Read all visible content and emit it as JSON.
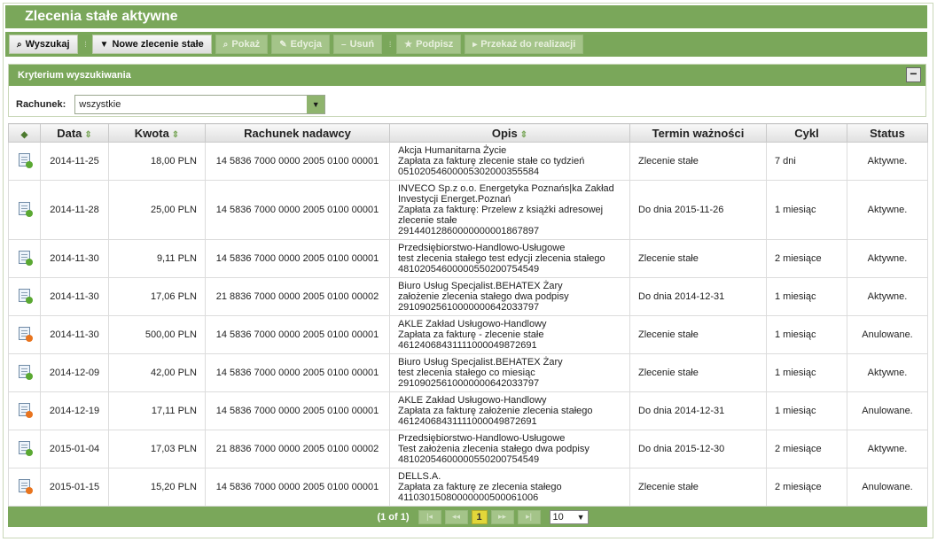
{
  "page_title": "Zlecenia stałe aktywne",
  "toolbar": {
    "buttons": [
      {
        "label": "Wyszukaj",
        "icon": "search-icon",
        "enabled": true
      },
      {
        "label": "Nowe zlecenie stałe",
        "icon": "dropdown-arrow-icon",
        "enabled": true
      },
      {
        "label": "Pokaż",
        "icon": "magnifier-icon",
        "enabled": false
      },
      {
        "label": "Edycja",
        "icon": "pencil-icon",
        "enabled": false
      },
      {
        "label": "Usuń",
        "icon": "minus-icon",
        "enabled": false
      },
      {
        "label": "Podpisz",
        "icon": "star-icon",
        "enabled": false
      },
      {
        "label": "Przekaż do realizacji",
        "icon": "arrow-right-icon",
        "enabled": false
      }
    ]
  },
  "criteria": {
    "title": "Kryterium wyszukiwania",
    "collapse_symbol": "−",
    "account_label": "Rachunek:",
    "account_value": "wszystkie"
  },
  "table": {
    "columns": [
      "",
      "Data",
      "Kwota",
      "Rachunek nadawcy",
      "Opis",
      "Termin ważności",
      "Cykl",
      "Status"
    ],
    "sort_symbol": "⇕",
    "rows": [
      {
        "status_icon": "active",
        "date": "2014-11-25",
        "amount": "18,00 PLN",
        "account": "14 5836 7000 0000 2005 0100 00001",
        "desc": [
          "Akcja Humanitarna Życie",
          "Zapłata za fakturę zlecenie stałe co tydzień",
          "05102054600005302000355584"
        ],
        "validity": "Zlecenie stałe",
        "cycle": "7 dni",
        "status": "Aktywne."
      },
      {
        "status_icon": "active",
        "date": "2014-11-28",
        "amount": "25,00 PLN",
        "account": "14 5836 7000 0000 2005 0100 00001",
        "desc": [
          "INVECO Sp.z o.o. Energetyka Poznańs|ka Zakład",
          "Investycji Energet.Poznań",
          "Zapłata za fakturę: Przelew z książki adresowej",
          "zlecenie stałe",
          "29144012860000000001867897"
        ],
        "validity": "Do dnia 2015-11-26",
        "cycle": "1 miesiąc",
        "status": "Aktywne."
      },
      {
        "status_icon": "active",
        "date": "2014-11-30",
        "amount": "9,11 PLN",
        "account": "14 5836 7000 0000 2005 0100 00001",
        "desc": [
          "Przedsiębiorstwo-Handlowo-Usługowe",
          "test zlecenia stałego test edycji zlecenia stałego",
          "48102054600000550200754549"
        ],
        "validity": "Zlecenie stałe",
        "cycle": "2 miesiące",
        "status": "Aktywne."
      },
      {
        "status_icon": "active",
        "date": "2014-11-30",
        "amount": "17,06 PLN",
        "account": "21 8836 7000 0000 2005 0100 00002",
        "desc": [
          "Biuro Usług Specjalist.BEHATEX Żary",
          "założenie zlecenia stałego dwa podpisy",
          "29109025610000000642033797"
        ],
        "validity": "Do dnia 2014-12-31",
        "cycle": "1 miesiąc",
        "status": "Aktywne."
      },
      {
        "status_icon": "cancelled",
        "date": "2014-11-30",
        "amount": "500,00 PLN",
        "account": "14 5836 7000 0000 2005 0100 00001",
        "desc": [
          "AKLE Zakład Usługowo-Handlowy",
          "Zapłata za fakturę - zlecenie stałe",
          "46124068431111000049872691"
        ],
        "validity": "Zlecenie stałe",
        "cycle": "1 miesiąc",
        "status": "Anulowane."
      },
      {
        "status_icon": "active",
        "date": "2014-12-09",
        "amount": "42,00 PLN",
        "account": "14 5836 7000 0000 2005 0100 00001",
        "desc": [
          "Biuro Usług Specjalist.BEHATEX Żary",
          "test zlecenia stałego co miesiąc",
          "29109025610000000642033797"
        ],
        "validity": "Zlecenie stałe",
        "cycle": "1 miesiąc",
        "status": "Aktywne."
      },
      {
        "status_icon": "cancelled",
        "date": "2014-12-19",
        "amount": "17,11 PLN",
        "account": "14 5836 7000 0000 2005 0100 00001",
        "desc": [
          "AKLE Zakład Usługowo-Handlowy",
          "Zapłata za fakturę założenie zlecenia stałego",
          "46124068431111000049872691"
        ],
        "validity": "Do dnia 2014-12-31",
        "cycle": "1 miesiąc",
        "status": "Anulowane."
      },
      {
        "status_icon": "active",
        "date": "2015-01-04",
        "amount": "17,03 PLN",
        "account": "21 8836 7000 0000 2005 0100 00002",
        "desc": [
          "Przedsiębiorstwo-Handlowo-Usługowe",
          "Test założenia zlecenia stałego dwa podpisy",
          "48102054600000550200754549"
        ],
        "validity": "Do dnia 2015-12-30",
        "cycle": "2 miesiące",
        "status": "Aktywne."
      },
      {
        "status_icon": "cancelled",
        "date": "2015-01-15",
        "amount": "15,20 PLN",
        "account": "14 5836 7000 0000 2005 0100 00001",
        "desc": [
          "DELLS.A.",
          "Zapłata za fakturę ze zlecenia stałego",
          "41103015080000000500061006"
        ],
        "validity": "Zlecenie stałe",
        "cycle": "2 miesiące",
        "status": "Anulowane."
      }
    ]
  },
  "pager": {
    "info": "(1 of 1)",
    "first": "|◂",
    "prev": "◂◂",
    "current_page": "1",
    "next": "▸▸",
    "last": "▸|",
    "page_size": "10",
    "page_size_arrow": "▼"
  },
  "colors": {
    "accent_green": "#7aa75a",
    "active_mark": "#5aa832",
    "cancelled_mark": "#e8741e"
  }
}
